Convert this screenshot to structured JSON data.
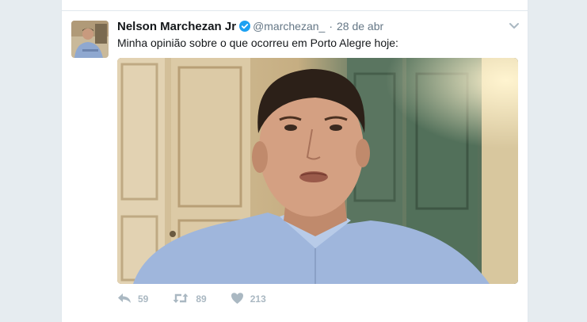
{
  "tweet": {
    "author_name": "Nelson Marchezan Jr",
    "author_handle": "@marchezan_",
    "separator": "·",
    "timestamp": "28 de abr",
    "text": "Minha opinião sobre o que ocorreu em Porto Alegre hoje:",
    "media_type": "video",
    "verified_icon": "verified-badge-icon",
    "menu_icon": "chevron-down-icon"
  },
  "actions": {
    "reply_count": "59",
    "retweet_count": "89",
    "like_count": "213",
    "reply_icon": "reply-icon",
    "retweet_icon": "retweet-icon",
    "like_icon": "heart-icon"
  },
  "colors": {
    "background": "#e6ecf0",
    "verified": "#1da1f2",
    "muted": "#657786",
    "action": "#aab8c2"
  }
}
